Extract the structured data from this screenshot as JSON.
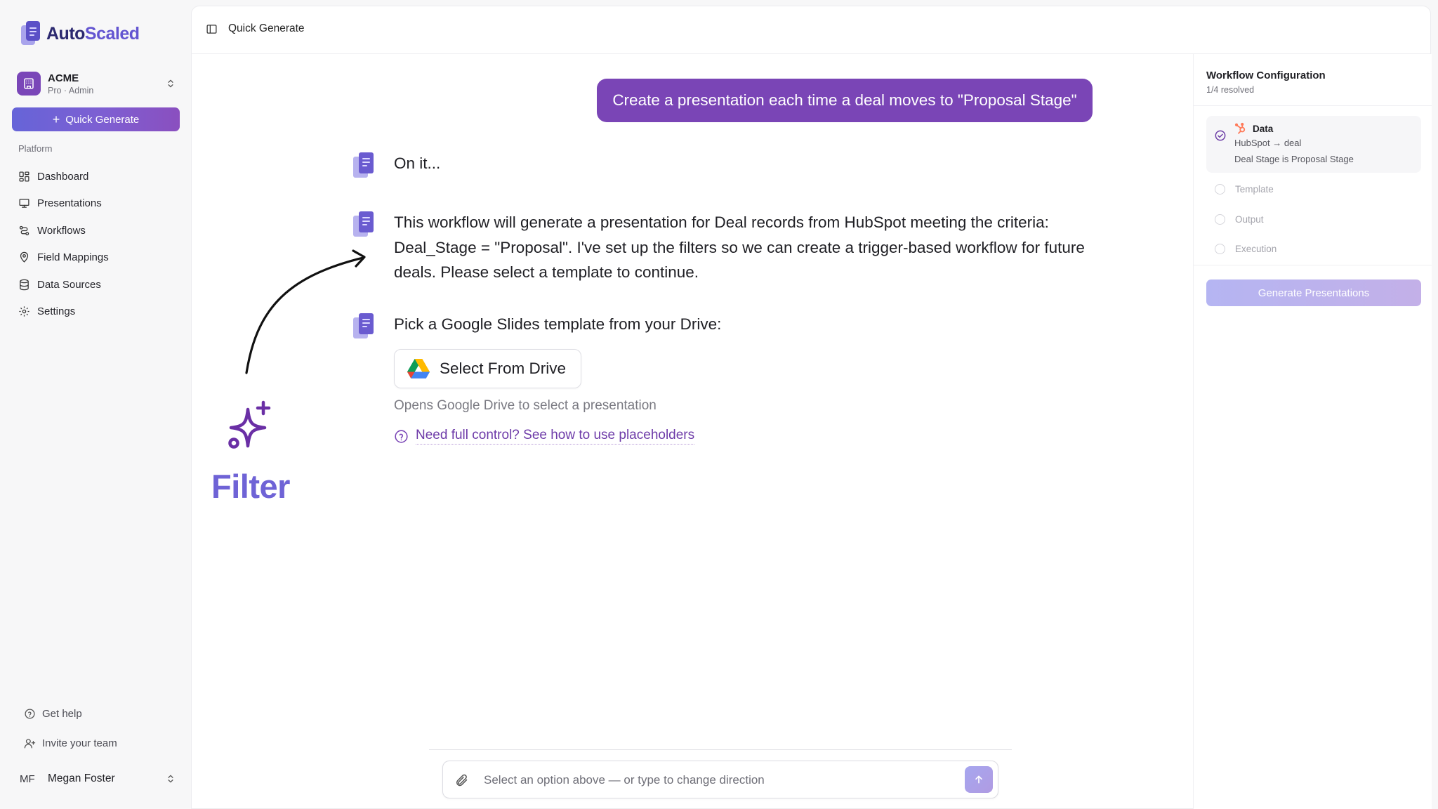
{
  "brand": {
    "part1": "Auto",
    "part2": "Scaled"
  },
  "org": {
    "name": "ACME",
    "subtitle": "Pro · Admin"
  },
  "sidebar": {
    "quick_generate": "Quick Generate",
    "section_label": "Platform",
    "items": [
      {
        "label": "Dashboard",
        "icon": "dashboard-icon"
      },
      {
        "label": "Presentations",
        "icon": "presentation-icon"
      },
      {
        "label": "Workflows",
        "icon": "workflow-icon"
      },
      {
        "label": "Field Mappings",
        "icon": "map-pin-icon"
      },
      {
        "label": "Data Sources",
        "icon": "database-icon"
      },
      {
        "label": "Settings",
        "icon": "gear-icon"
      }
    ],
    "footer": [
      {
        "label": "Get help",
        "icon": "help-circle-icon"
      },
      {
        "label": "Invite your team",
        "icon": "user-plus-icon"
      }
    ],
    "user": {
      "initials": "MF",
      "name": "Megan Foster"
    }
  },
  "header": {
    "title": "Quick Generate"
  },
  "chat": {
    "user_message": "Create a presentation each time a deal moves to \"Proposal Stage\"",
    "messages": [
      {
        "text": "On it..."
      },
      {
        "lines": [
          "This workflow will generate a presentation for Deal records from HubSpot meeting the criteria:",
          "Deal_Stage = \"Proposal\". I've set up the filters so we can create a trigger-based workflow for future",
          "deals. Please select a template to continue."
        ]
      },
      {
        "text": "Pick a Google Slides template from your Drive:"
      }
    ],
    "drive_button": "Select From Drive",
    "drive_hint": "Opens Google Drive to select a presentation",
    "help_link": "Need full control? See how to use placeholders"
  },
  "annotation": {
    "label": "Filter"
  },
  "composer": {
    "placeholder": "Select an option above — or type to change direction"
  },
  "config": {
    "title": "Workflow Configuration",
    "progress": "1/4 resolved",
    "data_step": {
      "label": "Data",
      "source": "HubSpot → deal",
      "filter": "Deal Stage is Proposal Stage"
    },
    "pending_steps": [
      "Template",
      "Output",
      "Execution"
    ],
    "generate_button": "Generate Presentations"
  },
  "colors": {
    "accent": "#7a45b6",
    "brand_dark": "#2c2970",
    "brand_light": "#6355d1",
    "annotation": "#6f63d6",
    "hubspot": "#ff7a59"
  }
}
